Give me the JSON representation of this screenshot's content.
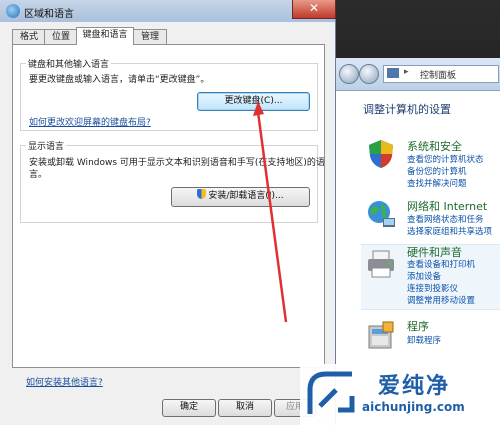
{
  "dialog": {
    "title": "区域和语言",
    "close_glyph": "✕",
    "tabs": [
      "格式",
      "位置",
      "键盘和语言",
      "管理"
    ],
    "keyboard_group": {
      "label": "键盘和其他输入语言",
      "description": "要更改键盘或输入语言，请单击“更改键盘”。",
      "button": "更改键盘(C)...",
      "link": "如何更改欢迎屏幕的键盘布局?"
    },
    "display_group": {
      "label": "显示语言",
      "description_line1": "安装或卸载 Windows 可用于显示文本和识别语音和手写(在支持地区)的语",
      "description_line2": "言。",
      "button": "安装/卸载语言(I)..."
    },
    "bottom_link": "如何安装其他语言?",
    "ok": "确定",
    "cancel": "取消",
    "apply": "应用"
  },
  "control_panel": {
    "address": "控制面板",
    "address_sep": "▸",
    "heading": "调整计算机的设置",
    "categories": [
      {
        "title": "系统和安全",
        "links": [
          "查看您的计算机状态",
          "备份您的计算机",
          "查找并解决问题"
        ]
      },
      {
        "title": "网络和 Internet",
        "links": [
          "查看网络状态和任务",
          "选择家庭组和共享选项"
        ]
      },
      {
        "title": "硬件和声音",
        "links": [
          "查看设备和打印机",
          "添加设备",
          "连接到投影仪",
          "调整常用移动设置"
        ]
      },
      {
        "title": "程序",
        "links": [
          "卸载程序"
        ]
      }
    ]
  },
  "annotation": {
    "color": "#e03030"
  },
  "watermark": {
    "text": "爱纯净",
    "url": "aichunjing.com"
  }
}
